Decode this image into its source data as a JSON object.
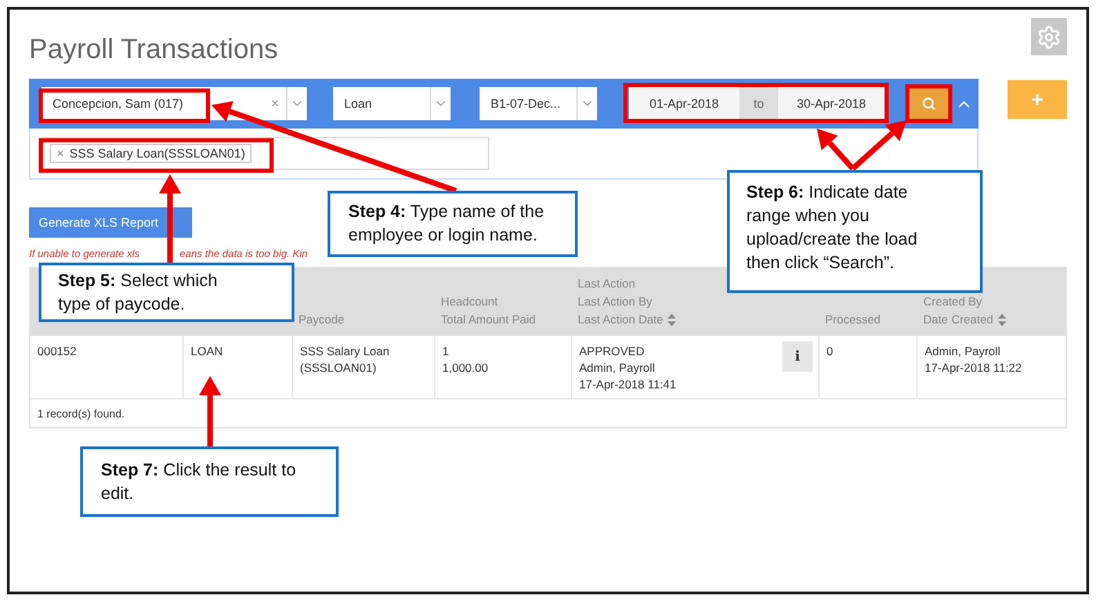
{
  "page": {
    "title": "Payroll Transactions",
    "add_button": "+"
  },
  "filters": {
    "expanded": true,
    "employee": {
      "value": "Concepcion, Sam (017)",
      "clear": "×"
    },
    "type": {
      "value": "Loan"
    },
    "batch": {
      "value": "B1-07-Dec..."
    },
    "date_from": "01-Apr-2018",
    "date_separator": "to",
    "date_to": "30-Apr-2018"
  },
  "paycode_tags": [
    {
      "label": "SSS Salary Loan(SSSLOAN01)",
      "remove": "×"
    }
  ],
  "generate_button": "Generate XLS Report",
  "warning": [
    "If unable to generate xls",
    "eans the data is too big. Kin"
  ],
  "table": {
    "columns": [
      "",
      "",
      {
        "lines": [
          "Paycode"
        ],
        "sortable": false
      },
      {
        "lines": [
          "Headcount",
          "Total Amount Paid"
        ],
        "sortable": false
      },
      {
        "lines": [
          "Last Action",
          "Last Action By",
          "Last Action Date"
        ],
        "sortable": true
      },
      {
        "lines": [
          "Processed"
        ],
        "sortable": false
      },
      {
        "lines": [
          "Created By",
          "Date Created"
        ],
        "sortable": true
      }
    ],
    "rows": [
      {
        "cells": [
          {
            "lines": [
              "000152"
            ]
          },
          {
            "lines": [
              "LOAN"
            ]
          },
          {
            "lines": [
              "SSS Salary Loan",
              "(SSSLOAN01)"
            ]
          },
          {
            "lines": [
              "1",
              "1,000.00"
            ]
          },
          {
            "lines": [
              "APPROVED",
              "Admin, Payroll",
              "17-Apr-2018 11:41"
            ],
            "info": "i"
          },
          {
            "lines": [
              "0"
            ]
          },
          {
            "lines": [
              "Admin, Payroll",
              "17-Apr-2018 11:22"
            ]
          }
        ]
      }
    ],
    "footer": "1 record(s) found."
  },
  "annotations": [
    {
      "text": "**Step 4:** Type name of the employee or login name."
    },
    {
      "text": "**Step 5:** Select which type of paycode."
    },
    {
      "text": "**Step 6:** Indicate date range when you upload/create the load then click “Search”."
    },
    {
      "text": "**Step 7:** Click the result to edit."
    }
  ]
}
